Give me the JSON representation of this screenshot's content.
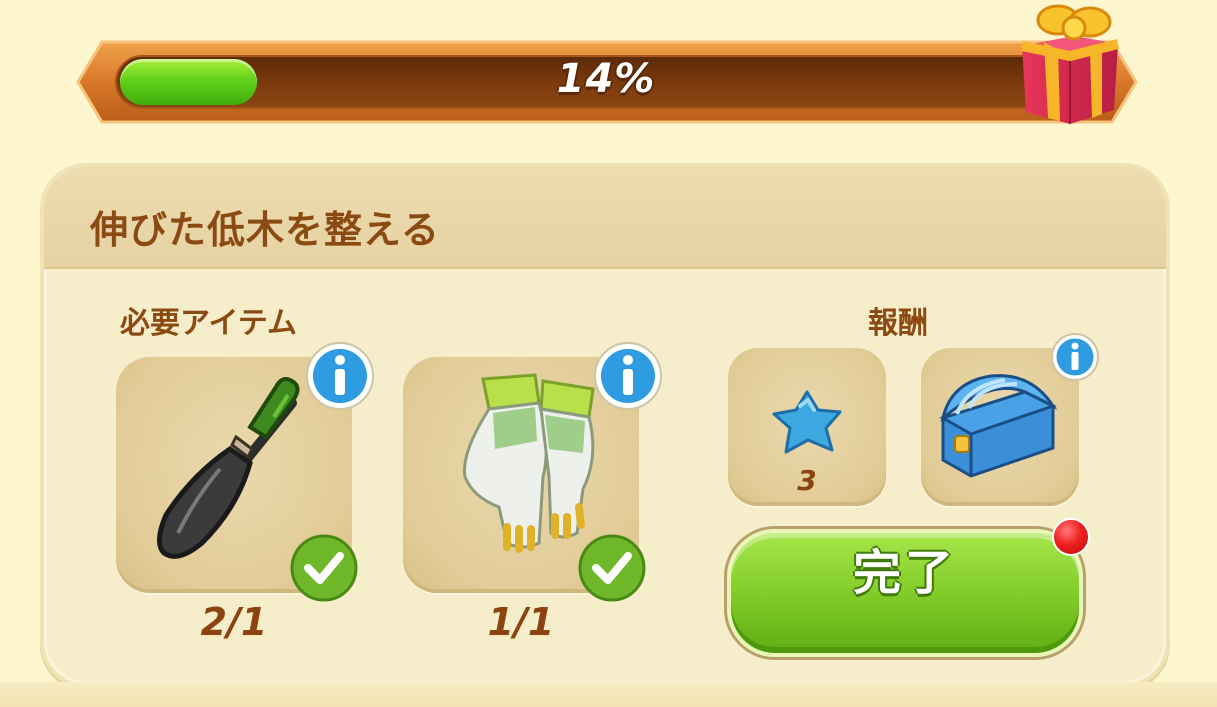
{
  "progress": {
    "percent_text": "14%",
    "fill_fraction": 0.14
  },
  "task": {
    "title": "伸びた低木を整える"
  },
  "required": {
    "label": "必要アイテム",
    "items": [
      {
        "icon": "trowel-icon",
        "count": "2/1",
        "status": "complete"
      },
      {
        "icon": "gardening-gloves-icon",
        "count": "1/1",
        "status": "complete"
      }
    ]
  },
  "rewards": {
    "label": "報酬",
    "items": [
      {
        "icon": "blue-star-icon",
        "count": "3"
      },
      {
        "icon": "blue-chest-icon",
        "count": ""
      }
    ]
  },
  "complete_button": {
    "label": "完了",
    "notification": true
  },
  "colors": {
    "text_brown": "#8b4a12",
    "bar_green": "#63d21a",
    "button_green": "#86cf2c",
    "notification_red": "#f02020"
  }
}
